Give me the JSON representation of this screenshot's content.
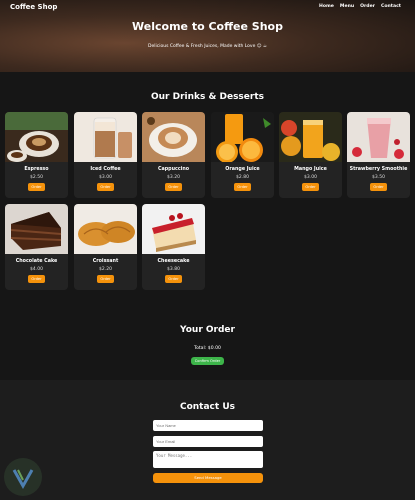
{
  "header": {
    "brand": "Coffee Shop",
    "nav": [
      "Home",
      "Menu",
      "Order",
      "Contact"
    ],
    "title": "Welcome to Coffee Shop",
    "subtitle": "Delicious Coffee & Fresh Juices, Made with Love ☺ ☕"
  },
  "menu": {
    "title": "Our Drinks & Desserts",
    "order_label": "Order",
    "items": [
      {
        "name": "Espresso",
        "price": "$2.50"
      },
      {
        "name": "Iced Coffee",
        "price": "$3.00"
      },
      {
        "name": "Cappuccino",
        "price": "$3.20"
      },
      {
        "name": "Orange Juice",
        "price": "$2.80"
      },
      {
        "name": "Mango Juice",
        "price": "$3.00"
      },
      {
        "name": "Strawberry Smoothie",
        "price": "$3.50"
      },
      {
        "name": "Chocolate Cake",
        "price": "$4.00"
      },
      {
        "name": "Croissant",
        "price": "$2.20"
      },
      {
        "name": "Cheesecake",
        "price": "$3.80"
      }
    ]
  },
  "order": {
    "title": "Your Order",
    "total": "Total: $0.00",
    "confirm_label": "Confirm Order"
  },
  "contact": {
    "title": "Contact Us",
    "name_placeholder": "Your Name",
    "email_placeholder": "Your Email",
    "message_placeholder": "Your Message...",
    "send_label": "Send Message"
  },
  "colors": {
    "accent": "#f5920b",
    "confirm": "#3db54a",
    "background": "#161616",
    "card": "#232323"
  }
}
